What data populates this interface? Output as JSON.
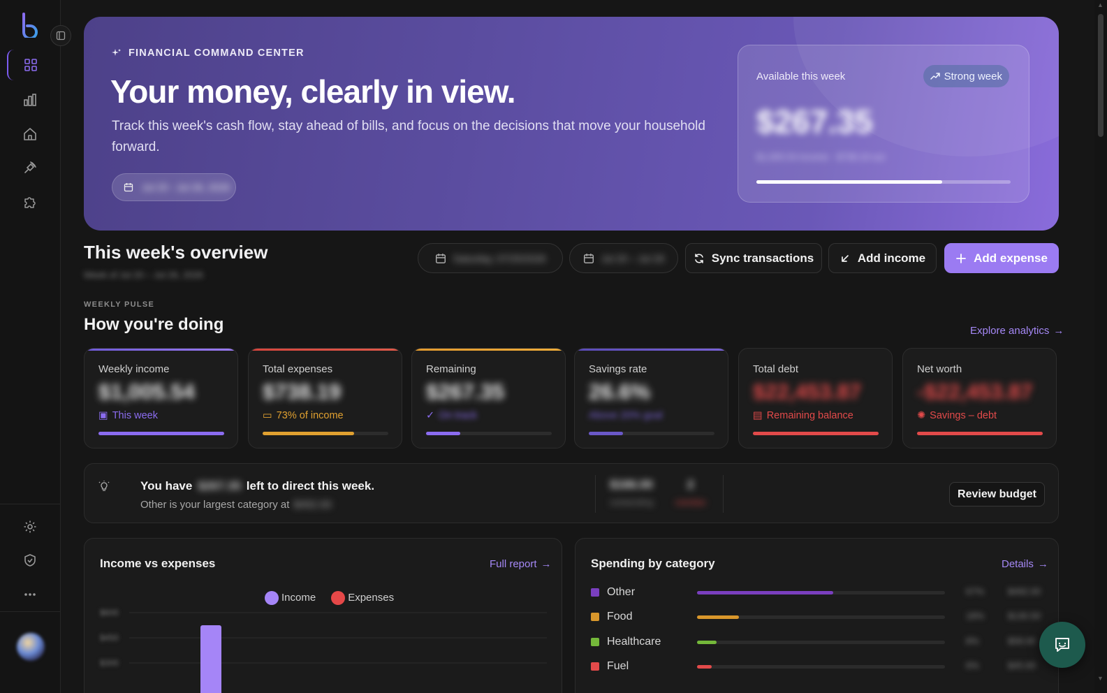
{
  "hero": {
    "eyebrow": "FINANCIAL COMMAND CENTER",
    "title": "Your money, clearly in view.",
    "subtitle": "Track this week's cash flow, stay ahead of bills, and focus on the decisions that move your household forward.",
    "date_pill": "Jul 20 - Jul 26, 2026",
    "available_label": "Available this week",
    "badge": "Strong week",
    "available_amount": "$267.35",
    "available_sub": "$1,005.54 income · $738.19 out",
    "progress": 0.73
  },
  "overview": {
    "title": "This week's overview",
    "subtitle": "Week of Jul 20 – Jul 26, 2026",
    "date_picker": "Saturday, 07/25/2026",
    "range_picker": "Jul 20 – Jul 26",
    "sync_label": "Sync transactions",
    "add_income_label": "Add income",
    "add_expense_label": "Add expense"
  },
  "pulse": {
    "eyebrow": "WEEKLY PULSE",
    "title": "How you're doing",
    "explore": "Explore analytics",
    "cards": [
      {
        "label": "Weekly income",
        "value": "$1,005.54",
        "note": "This week",
        "accent": "#8b6cf0",
        "progress": 1.0
      },
      {
        "label": "Total expenses",
        "value": "$738.19",
        "note": "73% of income",
        "accent": "#e0a030",
        "progress": 0.73
      },
      {
        "label": "Remaining",
        "value": "$267.35",
        "note": "On track",
        "accent": "#8b6cf0",
        "progress": 0.27
      },
      {
        "label": "Savings rate",
        "value": "26.6%",
        "note": "Above 20% goal",
        "accent": "#6a58c8",
        "progress": 0.27
      },
      {
        "label": "Total debt",
        "value": "$22,453.87",
        "note": "Remaining balance",
        "accent": "#e24a4a",
        "progress": 1.0
      },
      {
        "label": "Net worth",
        "value": "-$22,453.87",
        "note": "Savings – debt",
        "accent": "#e24a4a",
        "progress": 1.0
      }
    ]
  },
  "insight": {
    "prefix": "You have",
    "amount": "$267.35",
    "suffix": "left to direct this week.",
    "sub_prefix": "Other is your largest category at",
    "sub_amount": "$492.00",
    "mini1_value": "$166.00",
    "mini1_label": "outstanding",
    "mini2_value": "2",
    "mini2_label": "overdue",
    "review_label": "Review budget"
  },
  "income_chart": {
    "title": "Income vs expenses",
    "link": "Full report",
    "legend_income": "Income",
    "legend_expenses": "Expenses",
    "y_ticks": [
      "$600",
      "$450",
      "$300"
    ],
    "colors": {
      "income": "#a585f7",
      "expenses": "#e54848"
    }
  },
  "chart_data": {
    "type": "bar",
    "series": [
      {
        "name": "Income",
        "values": [
          1005.54
        ]
      },
      {
        "name": "Expenses",
        "values": [
          0
        ]
      }
    ],
    "ylim": [
      0,
      600
    ]
  },
  "spending": {
    "title": "Spending by category",
    "link": "Details",
    "items": [
      {
        "name": "Other",
        "color": "#7a3fbf",
        "pct": "67%",
        "amount": "$492.00",
        "share": 0.55
      },
      {
        "name": "Food",
        "color": "#d9972b",
        "pct": "18%",
        "amount": "$130.50",
        "share": 0.17
      },
      {
        "name": "Healthcare",
        "color": "#74b83a",
        "pct": "8%",
        "amount": "$58.00",
        "share": 0.08
      },
      {
        "name": "Fuel",
        "color": "#e24a4a",
        "pct": "6%",
        "amount": "$45.00",
        "share": 0.06
      }
    ]
  }
}
